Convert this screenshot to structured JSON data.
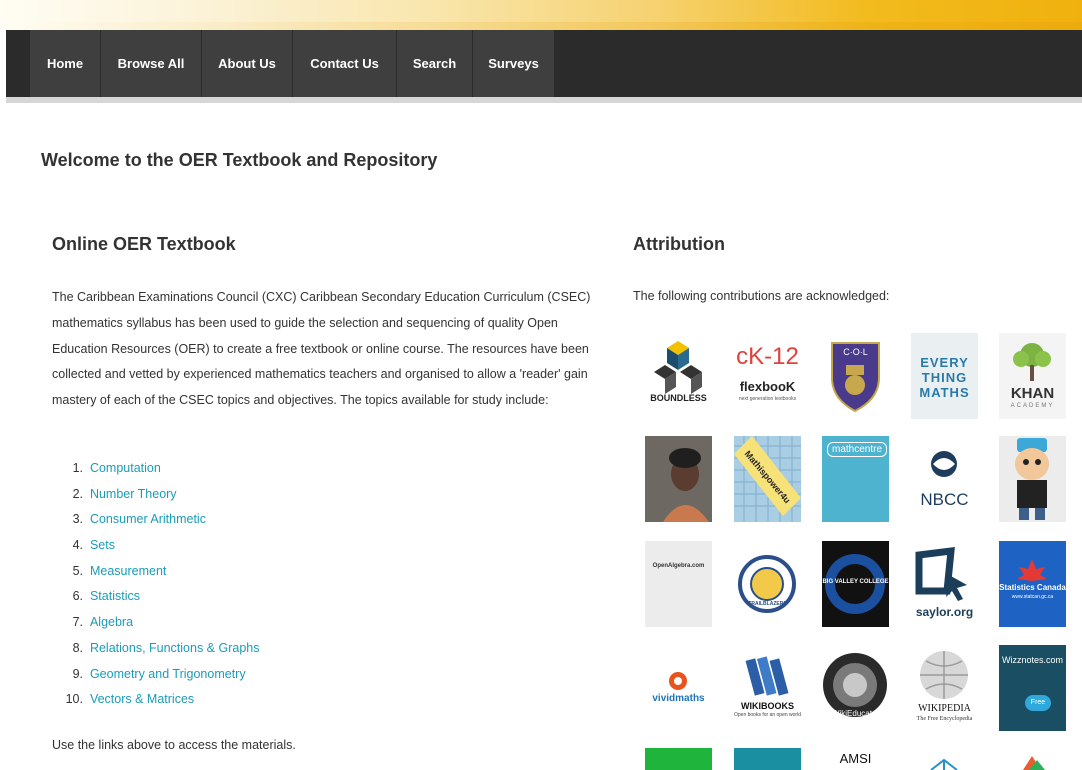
{
  "nav": {
    "items": [
      {
        "label": "Home"
      },
      {
        "label": "Browse All"
      },
      {
        "label": "About Us"
      },
      {
        "label": "Contact Us"
      },
      {
        "label": "Search"
      },
      {
        "label": "Surveys"
      }
    ]
  },
  "page": {
    "title": "Welcome to the OER Textbook and Repository"
  },
  "textbook": {
    "heading": "Online OER Textbook",
    "intro": "The Caribbean Examinations Council (CXC) Caribbean Secondary Education Curriculum (CSEC) mathematics syllabus has been used to guide the selection and sequencing of quality Open Education Resources (OER) to create a free textbook or online course. The resources have been collected and vetted by experienced mathematics teachers and organised to allow a 'reader' gain mastery of each of the CSEC topics and objectives. The topics available for study include:",
    "topics": [
      {
        "num": "1.",
        "label": "Computation"
      },
      {
        "num": "2.",
        "label": "Number Theory"
      },
      {
        "num": "3.",
        "label": "Consumer Arithmetic"
      },
      {
        "num": "4.",
        "label": "Sets"
      },
      {
        "num": "5.",
        "label": "Measurement"
      },
      {
        "num": "6.",
        "label": "Statistics"
      },
      {
        "num": "7.",
        "label": "Algebra"
      },
      {
        "num": "8.",
        "label": "Relations, Functions & Graphs"
      },
      {
        "num": "9.",
        "label": "Geometry and Trigonometry"
      },
      {
        "num": "10.",
        "label": "Vectors & Matrices"
      }
    ],
    "outro": "Use the links above to access the materials."
  },
  "attribution": {
    "heading": "Attribution",
    "text": "The following contributions are acknowledged:",
    "logos": {
      "boundless": "BOUNDLESS",
      "ck12_top": "cK-12",
      "ck12_bottom": "flexbooK",
      "ck12_tag": "next generation textbooks",
      "col": "C·O·L",
      "every_thing_maths": "EVERY THING MATHS",
      "khan": "KHAN",
      "khan_sub": "ACADEMY",
      "mathspower": "Mathispower4u",
      "mathcentre": "mathcentre",
      "nbcc": "NBCC",
      "openalgebra": "OpenAlgebra.com",
      "trailblazers": "TRAILBLAZERS",
      "big_valley": "BIG VALLEY COLLEGE",
      "saylor": "saylor.org",
      "statcan": "Statistics Canada",
      "statcan_url": "www.statcan.gc.ca",
      "vividmaths": "vividmaths",
      "wikibooks": "WIKIBOOKS",
      "wikibooks_sub": "Open books for an open world",
      "wikieducator": "WikiEducator",
      "wikipedia": "WIKIPEDIA",
      "wikipedia_sub": "The Free Encyclopedia",
      "wizznotes": "Wizznotes.com",
      "wizznotes_badge": "Free",
      "amsi": "AMSI"
    }
  }
}
